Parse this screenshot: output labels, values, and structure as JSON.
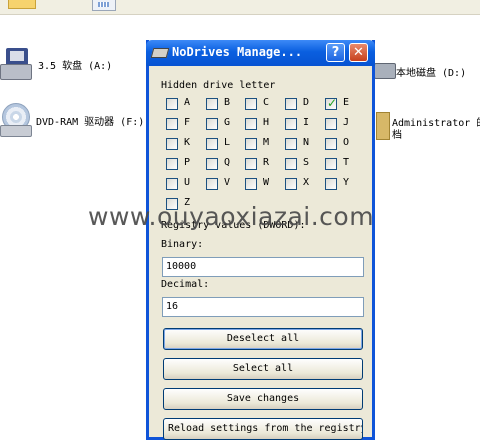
{
  "explorer": {
    "drives": [
      {
        "label": "3.5 软盘 (A:)",
        "icon": "floppy-drive-icon"
      },
      {
        "label": "DVD-RAM 驱动器 (F:)",
        "icon": "dvd-drive-icon"
      },
      {
        "label": "本地磁盘 (D:)",
        "icon": "hard-disk-icon"
      },
      {
        "label": "Administrator 的",
        "label2": "档",
        "icon": "folder-icon"
      }
    ]
  },
  "dialog": {
    "title": "NoDrives Manage...",
    "help_glyph": "?",
    "close_glyph": "✕",
    "hidden_label": "Hidden drive letter",
    "letters": [
      {
        "letter": "A",
        "checked": false
      },
      {
        "letter": "B",
        "checked": false
      },
      {
        "letter": "C",
        "checked": false
      },
      {
        "letter": "D",
        "checked": false
      },
      {
        "letter": "E",
        "checked": true
      },
      {
        "letter": "F",
        "checked": false
      },
      {
        "letter": "G",
        "checked": false
      },
      {
        "letter": "H",
        "checked": false
      },
      {
        "letter": "I",
        "checked": false
      },
      {
        "letter": "J",
        "checked": false
      },
      {
        "letter": "K",
        "checked": false
      },
      {
        "letter": "L",
        "checked": false
      },
      {
        "letter": "M",
        "checked": false
      },
      {
        "letter": "N",
        "checked": false
      },
      {
        "letter": "O",
        "checked": false
      },
      {
        "letter": "P",
        "checked": false
      },
      {
        "letter": "Q",
        "checked": false
      },
      {
        "letter": "R",
        "checked": false
      },
      {
        "letter": "S",
        "checked": false
      },
      {
        "letter": "T",
        "checked": false
      },
      {
        "letter": "U",
        "checked": false
      },
      {
        "letter": "V",
        "checked": false
      },
      {
        "letter": "W",
        "checked": false
      },
      {
        "letter": "X",
        "checked": false
      },
      {
        "letter": "Y",
        "checked": false
      },
      {
        "letter": "Z",
        "checked": false
      }
    ],
    "registry_label": "Registry values (DWORD):",
    "binary_label": "Binary:",
    "binary_value": "10000",
    "decimal_label": "Decimal:",
    "decimal_value": "16",
    "buttons": {
      "deselect_all": "Deselect all",
      "select_all": "Select all",
      "save_changes": "Save changes",
      "reload": "Reload settings from the registry"
    }
  },
  "watermark": "www.ouyaoxiazai.com",
  "colors": {
    "titlebar": "#0a5fe0",
    "dialog_bg": "#ece9d8",
    "check": "#21a121"
  }
}
